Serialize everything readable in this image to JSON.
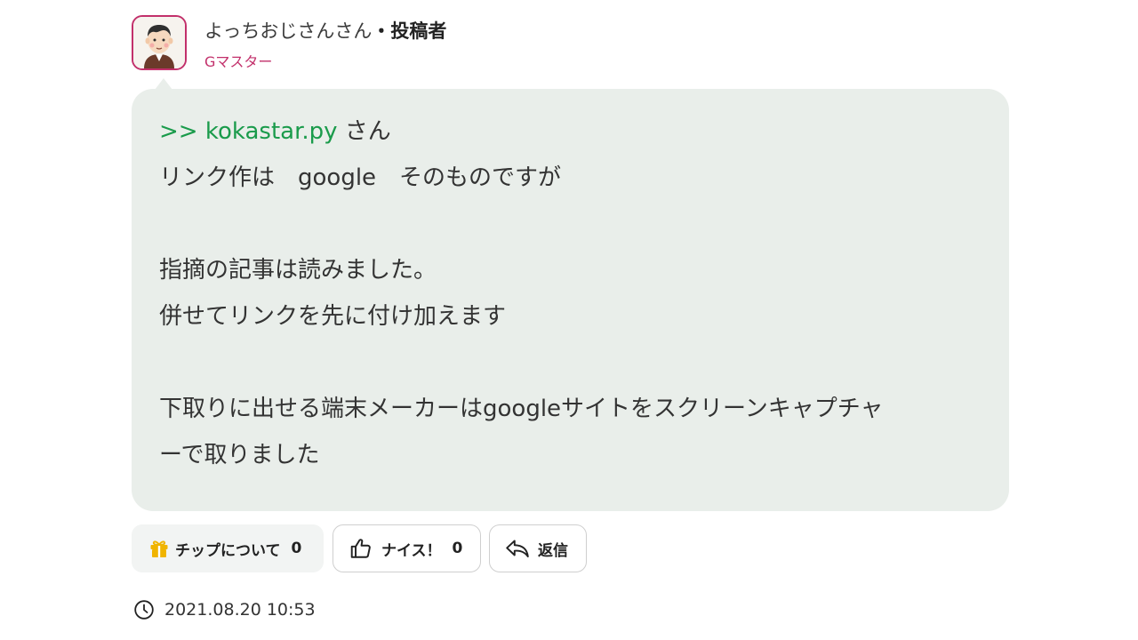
{
  "post": {
    "author_name": "よっちおじさんさん",
    "separator": "・",
    "author_role": "投稿者",
    "rank": "Gマスター",
    "mention_prefix": ">> ",
    "mention_user": "kokastar.py",
    "mention_suffix": " さん",
    "body_lines": [
      "リンク作は　google　そのものですが",
      "",
      "指摘の記事は読みました。",
      "併せてリンクを先に付け加えます",
      "",
      "下取りに出せる端末メーカーはgoogleサイトをスクリーンキャプチャ",
      "ーで取りました"
    ],
    "timestamp": "2021.08.20 10:53"
  },
  "actions": {
    "tip_label": "チップについて",
    "tip_count": "0",
    "nice_label": "ナイス！",
    "nice_count": "0",
    "reply_label": "返信"
  },
  "icons": {
    "avatar": "avatar-illustration",
    "tip": "gift-icon",
    "nice": "thumbs-up-icon",
    "reply": "reply-arrow-icon",
    "time": "clock-icon"
  },
  "colors": {
    "accent_pink": "#c2306b",
    "mention_green": "#1a9b4b",
    "bubble_bg": "#e9eeea",
    "gift_gold": "#f0b400"
  }
}
